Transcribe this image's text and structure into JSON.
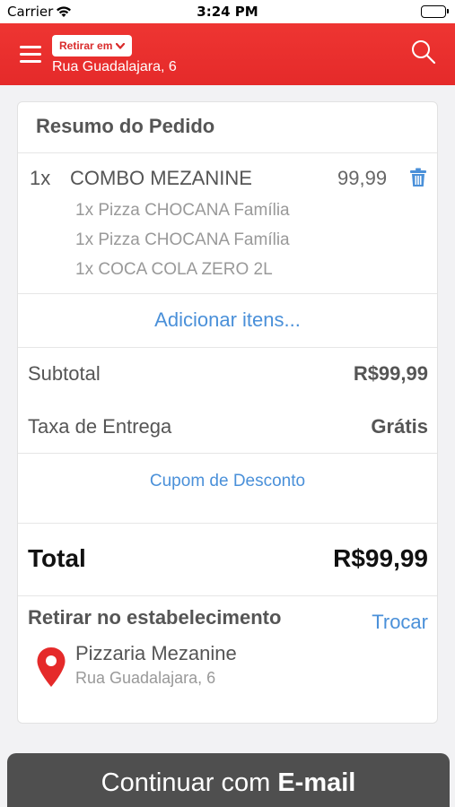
{
  "status_bar": {
    "carrier": "Carrier",
    "time": "3:24 PM"
  },
  "header": {
    "pickup_mode_label": "Retirar em",
    "address": "Rua Guadalajara, 6",
    "icons": [
      "menu-icon",
      "chevron-down-icon",
      "search-icon"
    ]
  },
  "order_summary": {
    "title": "Resumo do Pedido",
    "item": {
      "quantity": "1x",
      "name": "COMBO MEZANINE",
      "price": "99,99",
      "sub_items": [
        "1x Pizza CHOCANA Família",
        "1x Pizza CHOCANA Família",
        "1x COCA COLA ZERO 2L"
      ]
    },
    "add_items_link": "Adicionar itens...",
    "subtotal_label": "Subtotal",
    "subtotal_value": "R$99,99",
    "delivery_fee_label": "Taxa de Entrega",
    "delivery_fee_value": "Grátis",
    "coupon_link": "Cupom de Desconto",
    "total_label": "Total",
    "total_value": "R$99,99"
  },
  "pickup": {
    "title": "Retirar no estabelecimento",
    "change_link": "Trocar",
    "store_name": "Pizzaria Mezanine",
    "store_address": "Rua Guadalajara, 6"
  },
  "continue_button": {
    "prefix": "Continuar com",
    "method": "E-mail"
  },
  "colors": {
    "header_red": "#e52a2a",
    "link_blue": "#4a90d9",
    "button_gray": "#4f4f4f"
  }
}
